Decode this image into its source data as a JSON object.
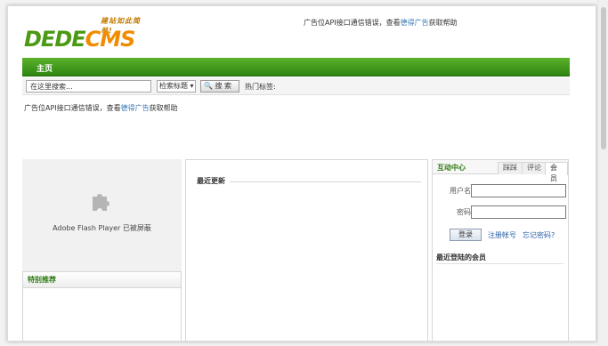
{
  "logo": {
    "slogan": "建站如此简单!",
    "word_part1": "DEDE",
    "word_part2": "CMS"
  },
  "top_ad": {
    "prefix": "广告位API接口通信错误，查看",
    "link": "德得广告",
    "suffix": "获取帮助"
  },
  "nav": {
    "home": "主页"
  },
  "search": {
    "placeholder": "在这里搜索...",
    "select": "检索标题 ▾",
    "button": "🔍 搜 索",
    "hot_label": "热门标签:"
  },
  "ad_line": {
    "prefix": "广告位API接口通信错误，查看",
    "link": "德得广告",
    "suffix": "获取帮助"
  },
  "flash": {
    "text": "Adobe Flash Player 已被屏蔽",
    "icon": "puzzle-piece-icon"
  },
  "special": {
    "title": "特别推荐"
  },
  "middle": {
    "title": "最近更新"
  },
  "member": {
    "title": "互动中心",
    "tabs": [
      "踩踩",
      "评论",
      "会员"
    ],
    "username_label": "用户名:",
    "password_label": "密码:",
    "login": "登录",
    "register": "注册帐号",
    "forgot": "忘记密码?",
    "recent": "最近登陆的会员"
  },
  "colors": {
    "nav_green": "#3a9617",
    "logo_green": "#4c9a14",
    "logo_orange": "#f08c00",
    "link_blue": "#2a62a8"
  }
}
